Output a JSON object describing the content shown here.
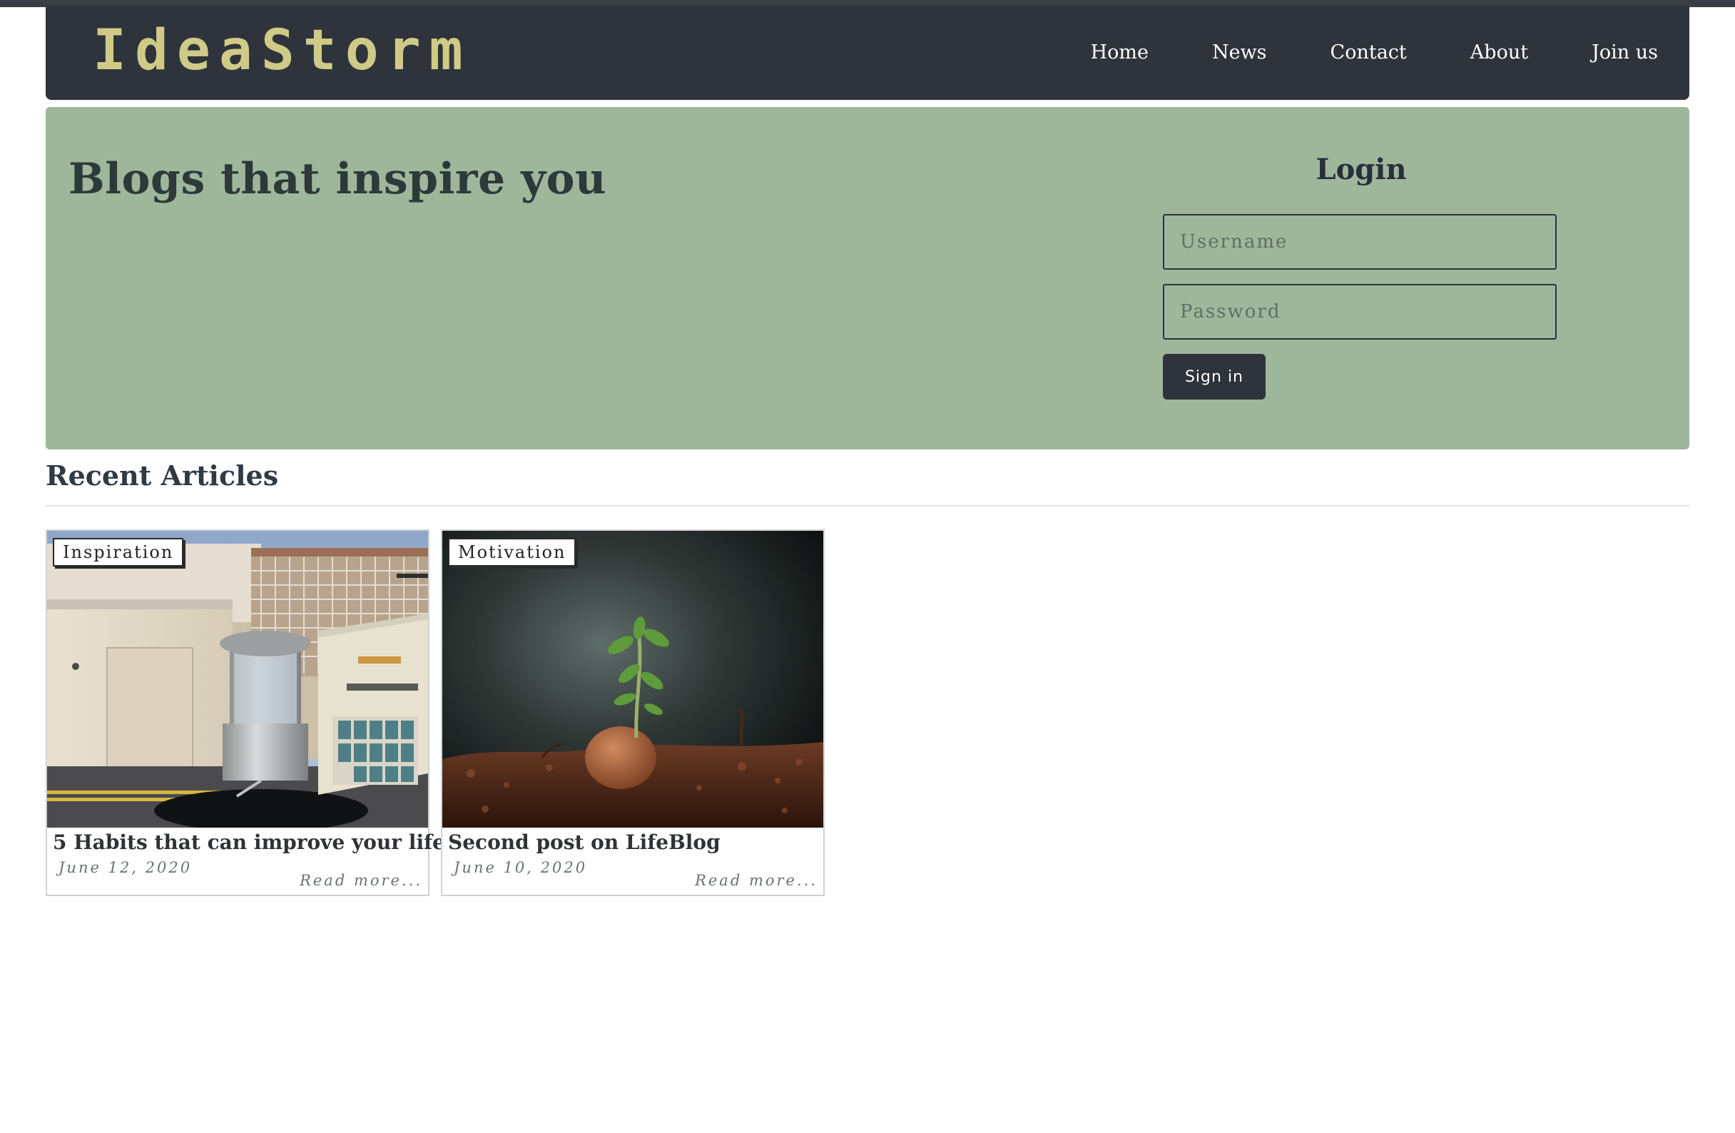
{
  "header": {
    "brand": "IdeaStorm",
    "nav": [
      "Home",
      "News",
      "Contact",
      "About",
      "Join us"
    ]
  },
  "hero": {
    "title": "Blogs that inspire you"
  },
  "login": {
    "title": "Login",
    "username_placeholder": "Username",
    "password_placeholder": "Password",
    "signin_label": "Sign in"
  },
  "recent": {
    "title": "Recent Articles",
    "articles": [
      {
        "category": "Inspiration",
        "title": "5 Habits that can improve your life",
        "date": "June 12, 2020",
        "read_more": "Read more..."
      },
      {
        "category": "Motivation",
        "title": "Second post on LifeBlog",
        "date": "June 10, 2020",
        "read_more": "Read more..."
      }
    ]
  },
  "colors": {
    "navbar": "#2f333b",
    "brand": "#cfca86",
    "hero": "#9eb79b",
    "button": "#2f333b"
  }
}
